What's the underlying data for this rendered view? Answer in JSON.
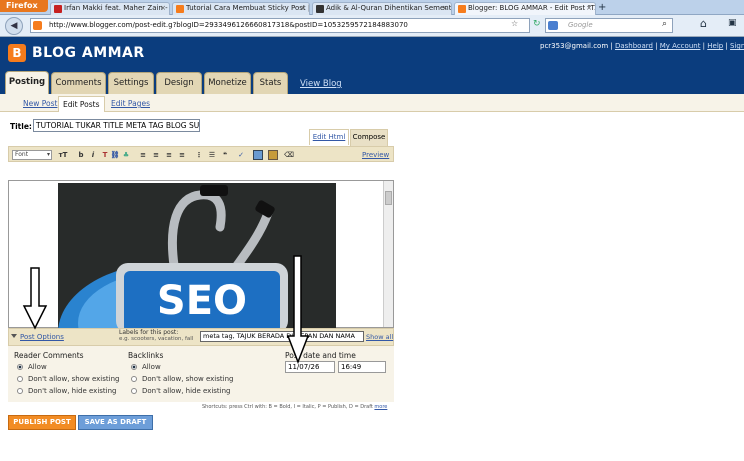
{
  "browser": {
    "firefox_label": "Firefox",
    "tabs": [
      {
        "label": "Irfan Makki feat. Maher Zain - I Believe..."
      },
      {
        "label": "Tutorial Cara Membuat Sticky Post | J..."
      },
      {
        "label": "Adik & Al-Quran Dihentikan Sementa..."
      },
      {
        "label": "Blogger: BLOG AMMAR - Edit Post \"T..."
      }
    ],
    "new_tab": "+",
    "url": "http://www.blogger.com/post-edit.g?blogID=2933496126660817318&postID=1053259572184883070",
    "search_placeholder": "Google"
  },
  "header": {
    "blog_name": "BLOG AMMAR",
    "email": "pcr353@gmail.com",
    "links": [
      "Dashboard",
      "My Account",
      "Help",
      "Sign out"
    ]
  },
  "main_tabs": [
    "Posting",
    "Comments",
    "Settings",
    "Design",
    "Monetize",
    "Stats"
  ],
  "view_blog": "View Blog",
  "sub_tabs": [
    "New Post",
    "Edit Posts",
    "Edit Pages"
  ],
  "editor": {
    "title_label": "Title:",
    "title_value": "TUTORIAL TUKAR TITLE META TAG BLOG SUP",
    "edit_html": "Edit Html",
    "compose": "Compose",
    "font_label": "Font",
    "preview": "Preview",
    "image_text": "SEO"
  },
  "options": {
    "post_options": "Post Options",
    "labels_title": "Labels for this post:",
    "labels_hint": "e.g. scooters, vacation, fall",
    "labels_value": "meta tag, TAJUK BERADA DI DEPAN DAN NAMA",
    "show_all": "Show all"
  },
  "settings": {
    "comments_heading": "Reader Comments",
    "comments": [
      "Allow",
      "Don't allow, show existing",
      "Don't allow, hide existing"
    ],
    "backlinks_heading": "Backlinks",
    "backlinks": [
      "Allow",
      "Don't allow, show existing",
      "Don't allow, hide existing"
    ],
    "date_heading": "Post date and time",
    "date_value": "11/07/26",
    "time_value": "16:49"
  },
  "shortcuts": {
    "text": "Shortcuts: press Ctrl with: B = Bold, I = Italic, P = Publish, D = Draft",
    "more": "more"
  },
  "buttons": {
    "publish": "PUBLISH POST",
    "draft": "SAVE AS DRAFT"
  },
  "colors": {
    "header_bg": "#0b3d7e",
    "publish": "#f28c24",
    "draft": "#6d9ed9",
    "link": "#3358a6"
  }
}
